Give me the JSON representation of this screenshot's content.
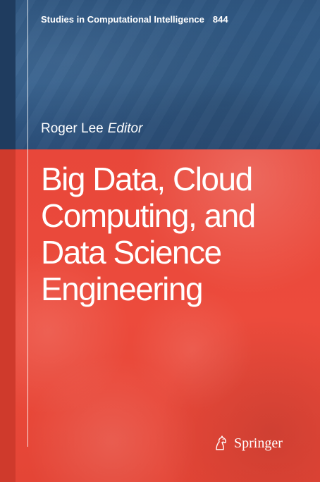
{
  "series": {
    "title": "Studies in Computational Intelligence",
    "volume": "844"
  },
  "editor": {
    "name": "Roger Lee",
    "role": "Editor"
  },
  "book": {
    "title_lines": [
      "Big Data, Cloud",
      "Computing, and",
      "Data Science",
      "Engineering"
    ]
  },
  "publisher": {
    "name": "Springer",
    "logo_icon": "springer-horse-icon"
  },
  "colors": {
    "top_band": "#345f8c",
    "bottom_band": "#ec4b3c",
    "text": "#ffffff"
  }
}
